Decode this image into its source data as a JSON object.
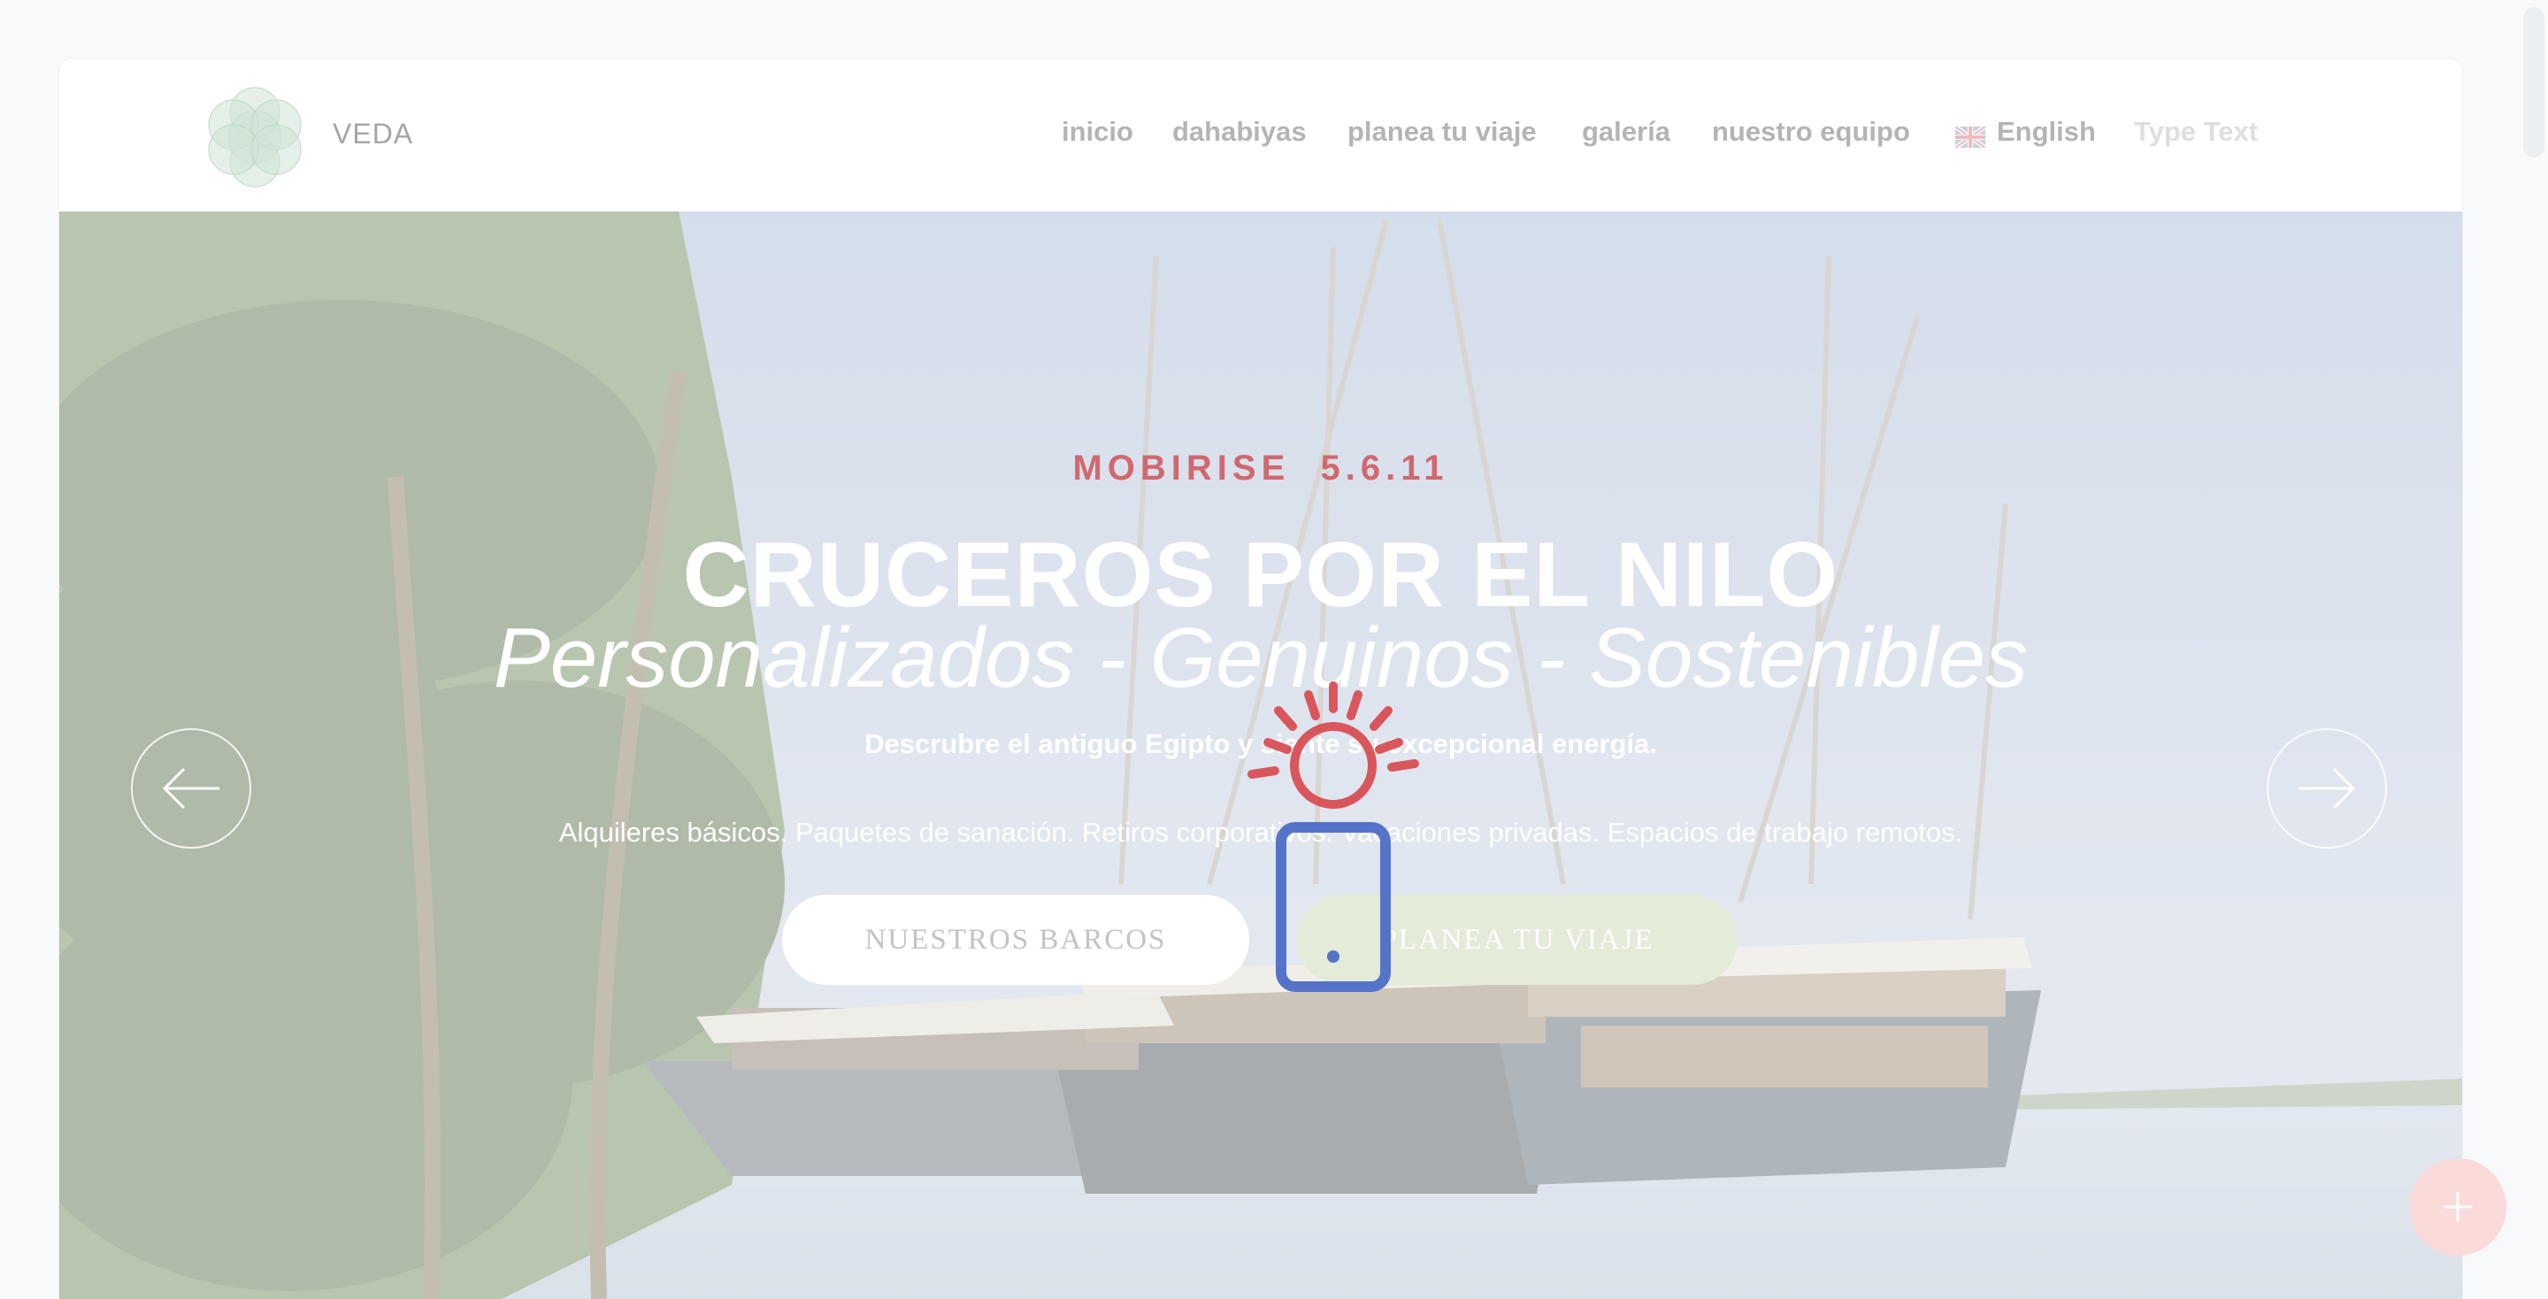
{
  "brand": {
    "name": "VEDA",
    "logo_icon": "flower-of-life-icon"
  },
  "nav": {
    "items": [
      "inicio",
      "dahabiyas",
      "planea tu viaje",
      "galería",
      "nuestro equipo"
    ],
    "language": "English",
    "language_icon": "uk-flag-icon",
    "type_text": "Type Text"
  },
  "hero": {
    "kicker": "MOBIRISE  5.6.11",
    "title": "CRUCEROS POR EL NILO",
    "subtitle": "Personalizados - Genuinos - Sostenibles",
    "tagline": "Descrubre el antiguo Egipto y siente su excepcional energía.",
    "description": "Alquileres básicos. Paquetes de sanación. Retiros corporativos. Vacaciones privadas. Espacios de trabajo remotos.",
    "buttons": {
      "boats": "NUESTROS BARCOS",
      "plan": "PLANEA TU VIAJE"
    },
    "background_image": "sailboats-on-nile-photo",
    "slides_total": 3,
    "active_slide": 1
  },
  "overlay": {
    "icon": "sun-and-mobile-icon"
  },
  "fab": {
    "icon": "plus-icon"
  },
  "colors": {
    "accent_red": "#d0696e",
    "accent_green": "#e4ebd9",
    "overlay_blue": "#5573c8",
    "nav_text": "#b4b4b4"
  }
}
